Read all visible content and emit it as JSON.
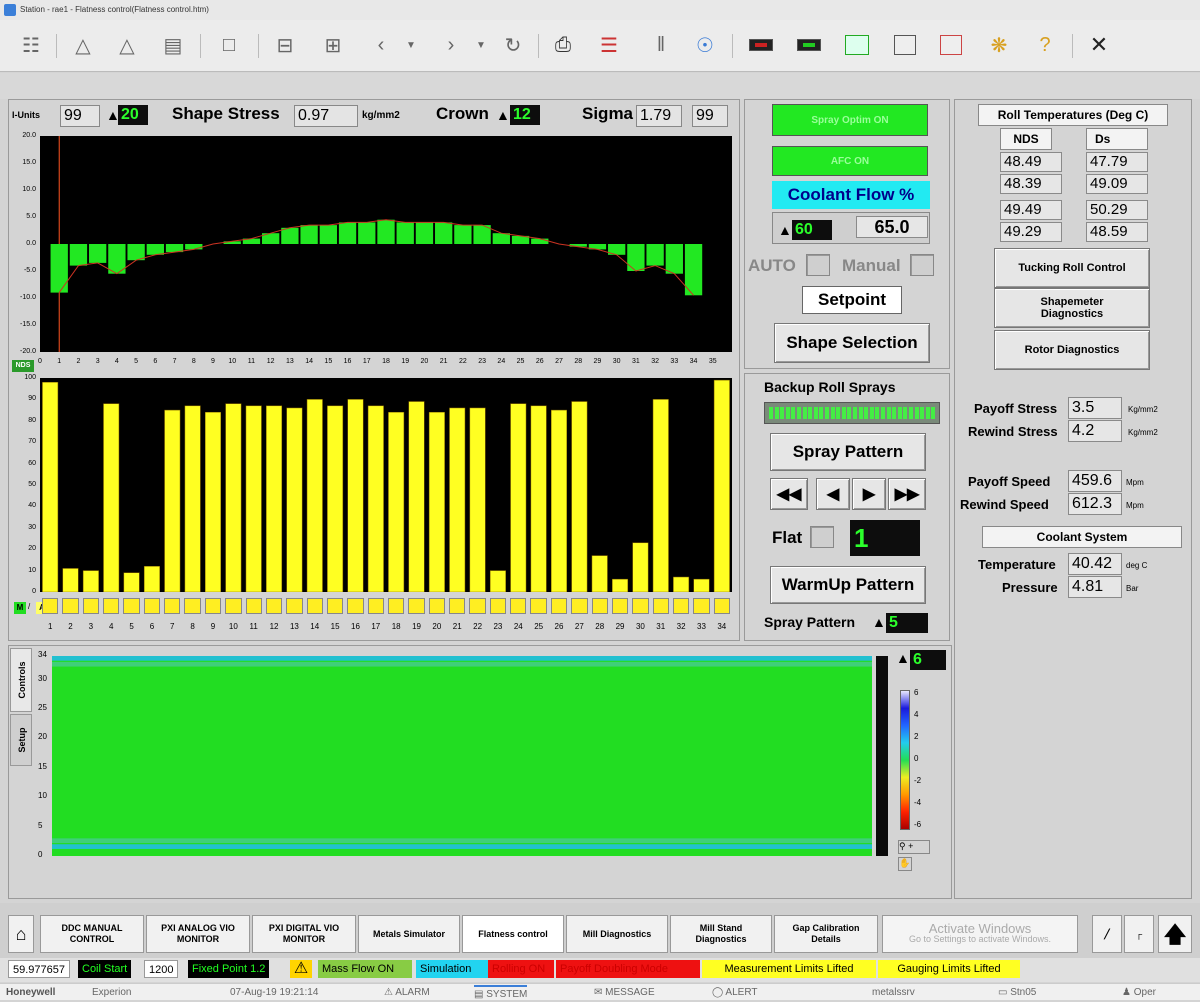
{
  "window": {
    "title": "Station - rae1 - Flatness control(Flatness control.htm)"
  },
  "header": {
    "i_units_label": "I-Units",
    "i_units_value": "99",
    "i_units_set": "20",
    "shape_stress_label": "Shape Stress",
    "shape_stress_value": "0.97",
    "shape_stress_unit": "kg/mm2",
    "crown_label": "Crown",
    "crown_set": "12",
    "sigma_label": "Sigma",
    "sigma_value": "1.79",
    "sigma_right": "99"
  },
  "controls": {
    "spray_optim": "Spray Optim ON",
    "afc": "AFC ON",
    "coolant_flow_title": "Coolant Flow %",
    "coolant_set": "60",
    "coolant_actual": "65.0",
    "auto_label": "AUTO",
    "manual_label": "Manual",
    "setpoint": "Setpoint",
    "shape_selection": "Shape Selection",
    "backup_title": "Backup Roll Sprays",
    "spray_pattern_button": "Spray Pattern",
    "flat_label": "Flat",
    "flat_value": "1",
    "warmup_pattern": "WarmUp Pattern",
    "spray_pattern_label": "Spray Pattern",
    "spray_pattern_value": "5"
  },
  "roll_temps": {
    "title": "Roll Temperatures (Deg C)",
    "col_nds": "NDS",
    "col_ds": "Ds",
    "nds": [
      "48.49",
      "48.39",
      "49.49",
      "49.29"
    ],
    "ds": [
      "47.79",
      "49.09",
      "50.29",
      "48.59"
    ]
  },
  "right_buttons": {
    "tucking": "Tucking Roll Control",
    "shapemeter_1": "Shapemeter",
    "shapemeter_2": "Diagnostics",
    "rotor": "Rotor Diagnostics"
  },
  "process": {
    "payoff_stress_label": "Payoff Stress",
    "payoff_stress": "3.5",
    "stress_unit": "Kg/mm2",
    "rewind_stress_label": "Rewind Stress",
    "rewind_stress": "4.2",
    "payoff_speed_label": "Payoff Speed",
    "payoff_speed": "459.6",
    "speed_unit": "Mpm",
    "rewind_speed_label": "Rewind Speed",
    "rewind_speed": "612.3"
  },
  "coolant_system": {
    "title": "Coolant System",
    "temperature_label": "Temperature",
    "temperature": "40.42",
    "temperature_unit": "deg C",
    "pressure_label": "Pressure",
    "pressure": "4.81",
    "pressure_unit": "Bar"
  },
  "side_tabs": {
    "controls": "Controls",
    "setup": "Setup"
  },
  "heatmap": {
    "spin_value": "6",
    "scale": [
      "6",
      "4",
      "2",
      "0",
      "-2",
      "-4",
      "-6"
    ]
  },
  "chart_data": [
    {
      "type": "bar",
      "label": "NDS",
      "ylim": [
        -20,
        20
      ],
      "yticks": [
        "20.0",
        "15.0",
        "10.0",
        "5.0",
        "0.0",
        "-5.0",
        "-10.0",
        "-15.0",
        "-20.0"
      ],
      "categories": [
        "1",
        "2",
        "3",
        "4",
        "5",
        "6",
        "7",
        "8",
        "9",
        "10",
        "11",
        "12",
        "13",
        "14",
        "15",
        "16",
        "17",
        "18",
        "19",
        "20",
        "21",
        "22",
        "23",
        "24",
        "25",
        "26",
        "27",
        "28",
        "29",
        "30",
        "31",
        "32",
        "33",
        "34"
      ],
      "xticks": [
        "0",
        "1",
        "2",
        "3",
        "4",
        "5",
        "6",
        "7",
        "8",
        "9",
        "10",
        "11",
        "12",
        "13",
        "14",
        "15",
        "16",
        "17",
        "18",
        "19",
        "20",
        "21",
        "22",
        "23",
        "24",
        "25",
        "26",
        "27",
        "28",
        "29",
        "30",
        "31",
        "32",
        "33",
        "34",
        "35"
      ],
      "values": [
        -9,
        -4,
        -3.5,
        -5.5,
        -3,
        -2,
        -1.5,
        -1,
        0,
        0.5,
        1,
        2,
        3,
        3.5,
        3.5,
        4,
        4,
        4.5,
        4,
        4,
        4,
        3.5,
        3.5,
        2,
        1.5,
        1,
        0,
        -0.5,
        -1,
        -2,
        -5,
        -4,
        -5.5,
        -9.5
      ],
      "colors": {
        "bar": "#22e822",
        "background": "#000000"
      }
    },
    {
      "type": "bar",
      "ylim": [
        0,
        100
      ],
      "yticks": [
        "100",
        "90",
        "80",
        "70",
        "60",
        "50",
        "40",
        "30",
        "20",
        "10",
        "0"
      ],
      "categories": [
        "1",
        "2",
        "3",
        "4",
        "5",
        "6",
        "7",
        "8",
        "9",
        "10",
        "11",
        "12",
        "13",
        "14",
        "15",
        "16",
        "17",
        "18",
        "19",
        "20",
        "21",
        "22",
        "23",
        "24",
        "25",
        "26",
        "27",
        "28",
        "29",
        "30",
        "31",
        "32",
        "33",
        "34"
      ],
      "values": [
        98,
        11,
        10,
        88,
        9,
        12,
        85,
        87,
        84,
        88,
        87,
        87,
        86,
        90,
        87,
        90,
        87,
        84,
        89,
        84,
        86,
        86,
        10,
        88,
        87,
        85,
        89,
        17,
        6,
        23,
        90,
        7,
        6,
        99
      ],
      "legend": [
        "M",
        "A"
      ],
      "colors": {
        "bar": "#ffff22",
        "background": "#000000"
      }
    },
    {
      "type": "heatmap",
      "yticks": [
        "34",
        "30",
        "25",
        "20",
        "15",
        "10",
        "5",
        "0"
      ],
      "colors": {
        "low": "#0000cc",
        "mid": "#22dd22",
        "high": "#ff0000"
      }
    }
  ],
  "nav": {
    "home": "home-icon",
    "items": [
      [
        "DDC MANUAL",
        "CONTROL"
      ],
      [
        "PXI ANALOG VIO",
        "MONITOR"
      ],
      [
        "PXI DIGITAL VIO",
        "MONITOR"
      ],
      [
        "Metals Simulator"
      ],
      [
        "Flatness control"
      ],
      [
        "Mill Diagnostics"
      ],
      [
        "Mill Stand",
        "Diagnostics"
      ],
      [
        "Gap Calibration",
        "Details"
      ]
    ],
    "activate_1": "Activate Windows",
    "activate_2": "Go to Settings to activate Windows."
  },
  "status": {
    "value": "59.977657",
    "coil_start": "Coil Start",
    "val_1200": "1200",
    "fixed_point": "Fixed Point 1.2",
    "mass_flow": "Mass Flow ON",
    "simulation": "Simulation",
    "rolling": "Rolling ON",
    "payoff_doubling": "Payoff Doubling Mode",
    "meas_limits": "Measurement Limits Lifted",
    "gauging_limits": "Gauging Limits Lifted"
  },
  "taskbar": {
    "brand": "Honeywell",
    "experion": "Experion",
    "datetime": "07-Aug-19  19:21:14",
    "alarm": "ALARM",
    "system": "SYSTEM",
    "message": "MESSAGE",
    "alert": "ALERT",
    "server": "metalssrv",
    "station": "Stn05",
    "user": "Oper"
  }
}
